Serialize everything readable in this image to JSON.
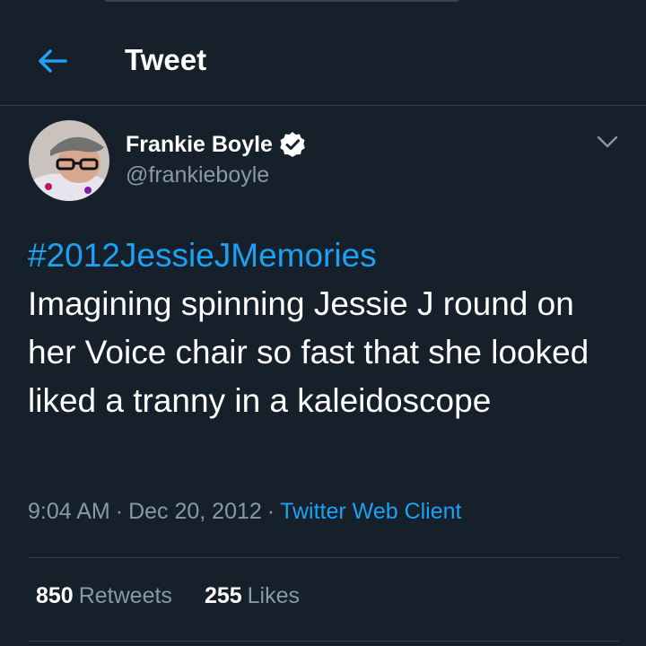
{
  "header": {
    "title": "Tweet",
    "back_icon": "back-arrow-icon"
  },
  "author": {
    "display_name": "Frankie Boyle",
    "handle": "@frankieboyle",
    "verified": true
  },
  "tweet": {
    "hashtag": "#2012JessieJMemories",
    "text": "Imagining spinning Jessie J round on her Voice chair so fast that she looked liked a tranny in a kaleidoscope"
  },
  "meta": {
    "time": "9:04 AM",
    "date": "Dec 20, 2012",
    "separator": "·",
    "client": "Twitter Web Client"
  },
  "stats": {
    "retweets_count": "850",
    "retweets_label": "Retweets",
    "likes_count": "255",
    "likes_label": "Likes"
  },
  "colors": {
    "background": "#15202b",
    "accent": "#1da1f2",
    "secondary_text": "#8899a6",
    "border": "#38444d"
  }
}
